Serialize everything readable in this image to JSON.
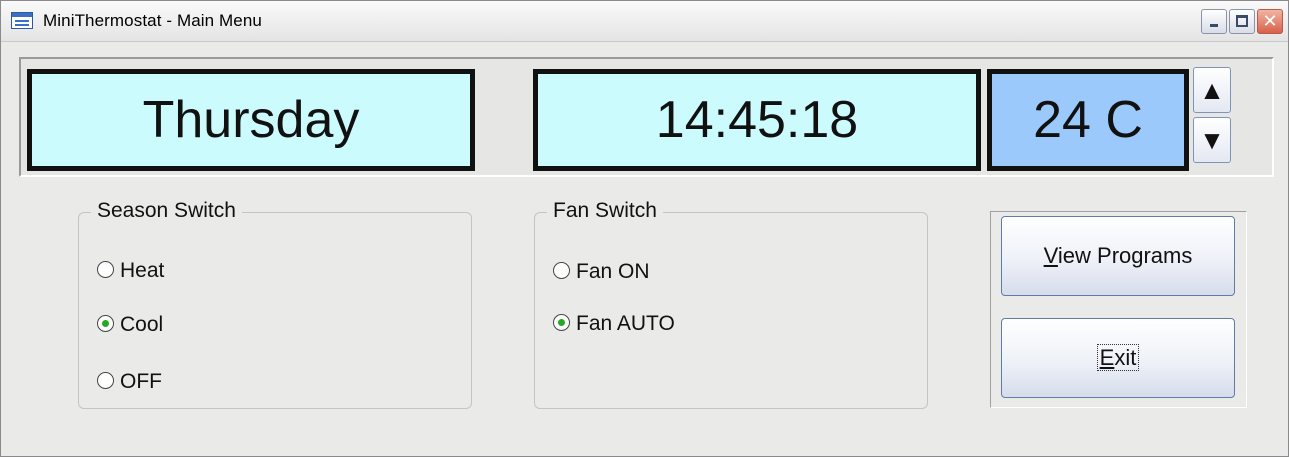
{
  "window": {
    "title": "MiniThermostat - Main Menu",
    "close_glyph": "✕"
  },
  "display": {
    "day": "Thursday",
    "time": "14:45:18",
    "temperature": "24 C",
    "spin_up": "▲",
    "spin_down": "▼"
  },
  "season_switch": {
    "label": "Season Switch",
    "options": [
      {
        "label": "Heat",
        "selected": false
      },
      {
        "label": "Cool",
        "selected": true
      },
      {
        "label": "OFF",
        "selected": false
      }
    ]
  },
  "fan_switch": {
    "label": "Fan Switch",
    "options": [
      {
        "label": "Fan ON",
        "selected": false
      },
      {
        "label": "Fan AUTO",
        "selected": true
      }
    ]
  },
  "buttons": {
    "view_programs_first": "V",
    "view_programs_rest": "iew Programs",
    "exit_first": "E",
    "exit_rest": "xit"
  },
  "colors": {
    "lcd_background": "#ccfbfd",
    "temp_background": "#9cc9fb",
    "radio_selected": "#22aa22"
  }
}
